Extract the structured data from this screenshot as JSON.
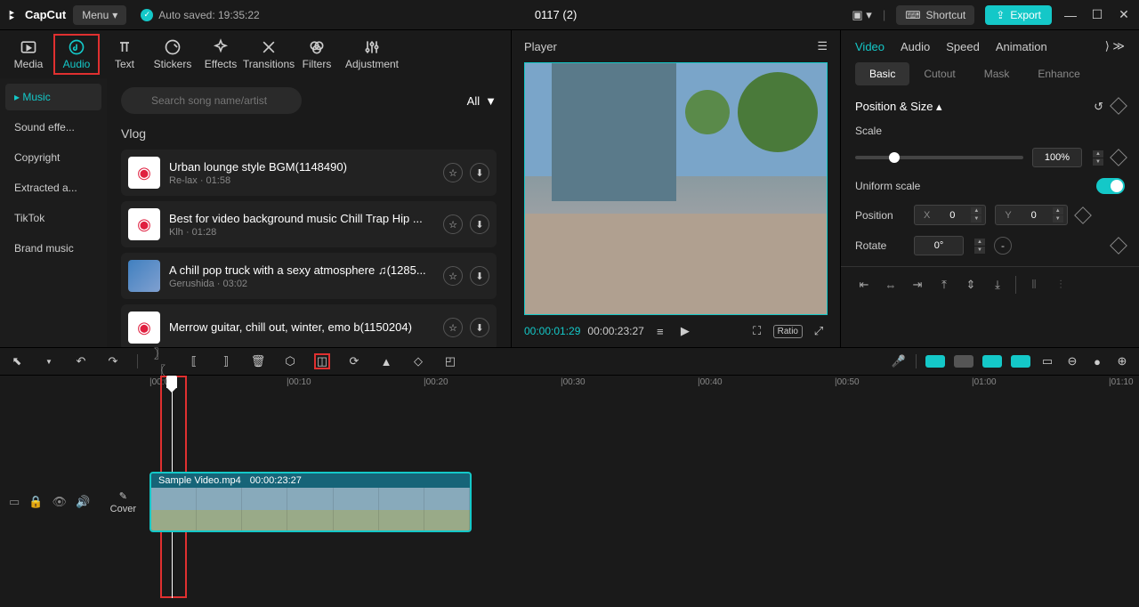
{
  "app": {
    "name": "CapCut",
    "menu": "Menu",
    "autosave": "Auto saved: 19:35:22",
    "title": "0117 (2)",
    "shortcut": "Shortcut",
    "export": "Export"
  },
  "mediaTabs": [
    "Media",
    "Audio",
    "Text",
    "Stickers",
    "Effects",
    "Transitions",
    "Filters",
    "Adjustment"
  ],
  "audioNav": [
    "Music",
    "Sound effe...",
    "Copyright",
    "Extracted a...",
    "TikTok",
    "Brand music"
  ],
  "search": {
    "placeholder": "Search song name/artist",
    "all": "All"
  },
  "section": "Vlog",
  "songs": [
    {
      "title": "Urban lounge style BGM(1148490)",
      "artist": "Re-lax",
      "dur": "01:58",
      "thumb": "red"
    },
    {
      "title": "Best for video background music Chill Trap Hip ...",
      "artist": "Klh",
      "dur": "01:28",
      "thumb": "red"
    },
    {
      "title": "A chill pop truck with a sexy atmosphere ♫(1285...",
      "artist": "Gerushida",
      "dur": "03:02",
      "thumb": "blue"
    },
    {
      "title": "Merrow guitar, chill out, winter, emo b(1150204)",
      "artist": "",
      "dur": "",
      "thumb": "red"
    }
  ],
  "player": {
    "label": "Player",
    "cur": "00:00:01:29",
    "dur": "00:00:23:27",
    "ratio": "Ratio"
  },
  "rightTabs": [
    "Video",
    "Audio",
    "Speed",
    "Animation"
  ],
  "rightSubtabs": [
    "Basic",
    "Cutout",
    "Mask",
    "Enhance"
  ],
  "props": {
    "sectionTitle": "Position & Size",
    "scale": "Scale",
    "scaleVal": "100%",
    "uniform": "Uniform scale",
    "position": "Position",
    "x": "X",
    "xval": "0",
    "y": "Y",
    "yval": "0",
    "rotate": "Rotate",
    "rotVal": "0°"
  },
  "clip": {
    "name": "Sample Video.mp4",
    "dur": "00:00:23:27"
  },
  "cover": "Cover",
  "ruler": [
    "00:00",
    "00:10",
    "00:20",
    "00:30",
    "00:40",
    "00:50",
    "01:00",
    "01:10"
  ]
}
